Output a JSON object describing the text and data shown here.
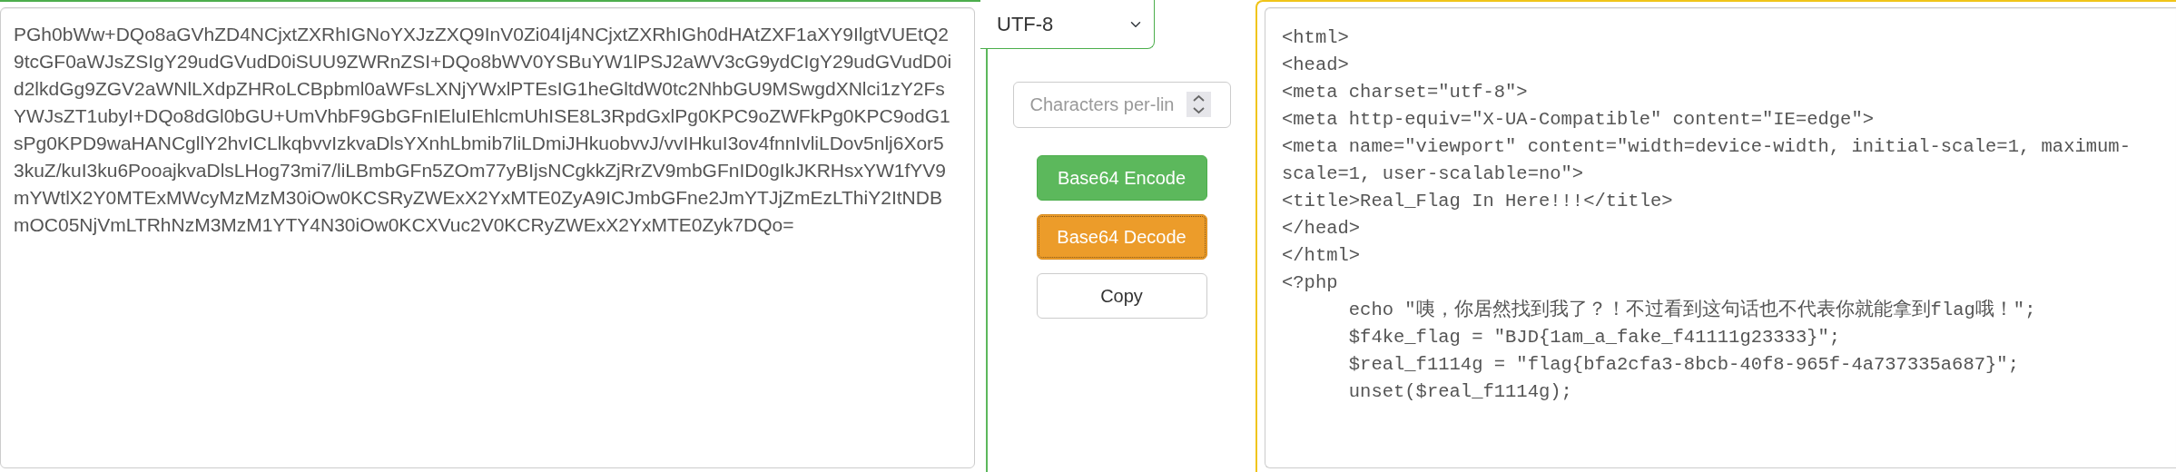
{
  "input": {
    "value": "PGh0bWw+DQo8aGVhZD4NCjxtZXRhIGNoYXJzZXQ9InV0Zi04Ij4NCjxtZXRhIGh0dHAtZXF1aXY9IlgtVUEtQ29tcGF0aWJsZSIgY29udGVudD0iSUU9ZWRnZSI+DQo8bWV0YSBuYW1lPSJ2aWV3cG9ydCIgY29udGVudD0id2lkdGg9ZGV2aWNlLXdpZHRoLCBpbml0aWFsLXNjYWxlPTEsIG1heGltdW0tc2NhbGU9MSwgdXNlci1zY2FsYWJsZT1ubyI+DQo8dGl0bGU+UmVhbF9GbGFnIEluIEhlcmUhISE8L3RpdGxlPg0KPC9oZWFkPg0KPC9odG1sPg0KPD9waHANCgllY2hvICLlkqbvvIzkvaDlsYXnhLbmib7liLDmiJHkuobvvJ/vvIHkuI3ov4fnnIvliLDov5nlj6Xor53kuZ/kuI3ku6PooajkvaDlsLHog73mi7/liLBmbGFn5ZOm77yBIjsNCgkkZjRrZV9mbGFnID0gIkJKRHsxYW1fYV9mYWtlX2Y0MTExMWcyMzMzM30iOw0KCSRyZWExX2YxMTE0ZyA9ICJmbGFne2JmYTJjZmEzLThiY2ItNDBmOC05NjVmLTRhNzM3MzM1YTY4N30iOw0KCXVuc2V0KCRyZWExX2YxMTE0Zyk7DQo="
  },
  "encoding": {
    "value": "UTF-8"
  },
  "line_length": {
    "placeholder": "Characters per-lin"
  },
  "buttons": [
    {
      "label": "Base64 Encode",
      "kind": "encode",
      "focused": false
    },
    {
      "label": "Base64 Decode",
      "kind": "decode",
      "focused": true
    },
    {
      "label": "Copy",
      "kind": "copy",
      "focused": false
    }
  ],
  "output_lines": [
    "<html>",
    "<head>",
    "<meta charset=\"utf-8\">",
    "<meta http-equiv=\"X-UA-Compatible\" content=\"IE=edge\">",
    "<meta name=\"viewport\" content=\"width=device-width, initial-scale=1, maximum-scale=1, user-scalable=no\">",
    "<title>Real_Flag In Here!!!</title>",
    "</head>",
    "</html>",
    "<?php",
    "\techo \"咦，你居然找到我了？！不过看到这句话也不代表你就能拿到flag哦！\";",
    "\t$f4ke_flag = \"BJD{1am_a_fake_f41111g23333}\";",
    "\t$real_f1114g = \"flag{bfa2cfa3-8bcb-40f8-965f-4a737335a687}\";",
    "\tunset($real_f1114g);"
  ]
}
